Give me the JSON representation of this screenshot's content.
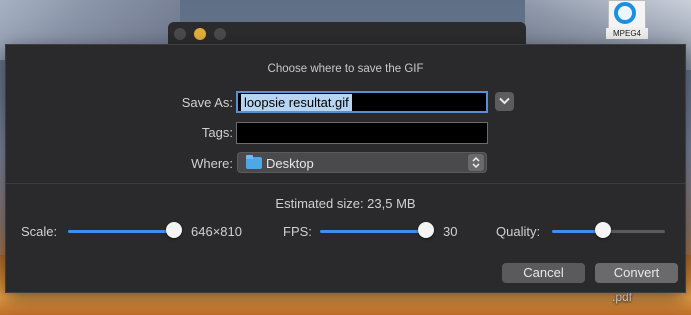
{
  "sheet": {
    "title": "Choose where to save the GIF",
    "save_as_label": "Save As:",
    "save_as_value": "loopsie resultat.gif",
    "tags_label": "Tags:",
    "tags_value": "",
    "where_label": "Where:",
    "where_value": "Desktop",
    "estimated_size": "Estimated size: 23,5 MB",
    "cancel_label": "Cancel",
    "convert_label": "Convert"
  },
  "sliders": {
    "scale": {
      "label": "Scale:",
      "value_text": "646×810",
      "level": 1.0
    },
    "fps": {
      "label": "FPS:",
      "value_text": "30",
      "level": 1.0
    },
    "quality": {
      "label": "Quality:",
      "level": 0.45
    }
  },
  "desktop": {
    "file_label": "MPEG4",
    "pdf_label": ".pdf"
  },
  "colors": {
    "accent": "#3d8ef0",
    "sheet_bg": "#2a2a2c",
    "selection": "#b7d4f3",
    "folder": "#4fa8e6"
  },
  "icons": [
    "quicktime-icon",
    "chevron-down-icon",
    "folder-icon",
    "updown-arrows-icon"
  ]
}
